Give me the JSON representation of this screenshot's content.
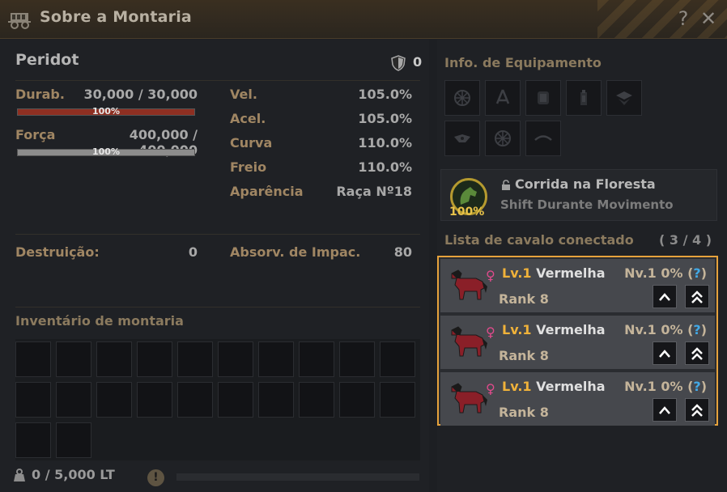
{
  "window": {
    "title": "Sobre a Montaria",
    "help_label": "?",
    "close_label": "✕"
  },
  "horse": {
    "name": "Peridot",
    "defense": "0",
    "durability": {
      "label": "Durab.",
      "value": "30,000 / 30,000",
      "percent_text": "100%",
      "fill": 1.0,
      "color": "#8e2f22"
    },
    "force": {
      "label": "Força",
      "value": "400,000 / 400,000",
      "percent_text": "100%",
      "fill": 1.0,
      "color": "#8c8c8c"
    },
    "stats": [
      {
        "label": "Vel.",
        "value": "105.0%"
      },
      {
        "label": "Acel.",
        "value": "105.0%"
      },
      {
        "label": "Curva",
        "value": "110.0%"
      },
      {
        "label": "Freio",
        "value": "110.0%"
      },
      {
        "label": "Aparência",
        "value": "Raça Nº18"
      }
    ],
    "destruction": {
      "label": "Destruição:",
      "value": "0"
    },
    "impact": {
      "label": "Absorv. de Impac.",
      "value": "80"
    }
  },
  "inventory": {
    "title": "Inventário de montaria",
    "slot_count": 22,
    "weight": "0 / 5,000 LT",
    "warn_label": "!"
  },
  "equipment": {
    "title": "Info. de Equipamento",
    "slots": [
      {
        "icon": "horseshoe-wheel-icon"
      },
      {
        "icon": "stirrup-icon"
      },
      {
        "icon": "saddle-icon"
      },
      {
        "icon": "lantern-icon"
      },
      {
        "icon": "barding-icon"
      },
      {
        "icon": "helmet-icon"
      },
      {
        "icon": "wheel-icon"
      },
      {
        "icon": "reins-icon"
      }
    ]
  },
  "skill": {
    "name": "Corrida na Floresta",
    "description": "Shift Durante Movimento",
    "percent": "100%"
  },
  "linked": {
    "title": "Lista de cavalo conectado",
    "count": "( 3 / 4 )",
    "items": [
      {
        "level": "Lv.1",
        "name": "Vermelha",
        "rank": "Rank 8",
        "nv": "Nv.1 0% (",
        "q": "?",
        "close": ")"
      },
      {
        "level": "Lv.1",
        "name": "Vermelha",
        "rank": "Rank 8",
        "nv": "Nv.1 0% (",
        "q": "?",
        "close": ")"
      },
      {
        "level": "Lv.1",
        "name": "Vermelha",
        "rank": "Rank 8",
        "nv": "Nv.1 0% (",
        "q": "?",
        "close": ")"
      }
    ]
  }
}
